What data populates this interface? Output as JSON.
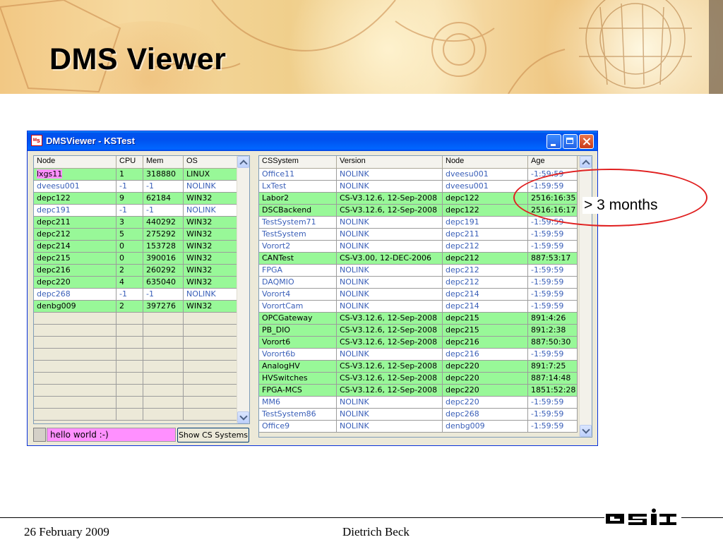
{
  "slide": {
    "title": "DMS Viewer",
    "footer_date": "26 February 2009",
    "footer_author": "Dietrich Beck",
    "logo_text": "GSI",
    "annotation": "> 3 months"
  },
  "window": {
    "title": "DMSViewer - KSTest",
    "icon": "app-icon"
  },
  "left_table": {
    "headers": [
      "Node",
      "CPU",
      "Mem",
      "OS"
    ],
    "rows": [
      {
        "node": "lxgs11",
        "cpu": "1",
        "mem": "318880",
        "os": "LINUX",
        "status": "ok",
        "highlight": true
      },
      {
        "node": "dveesu001",
        "cpu": "-1",
        "mem": "-1",
        "os": "NOLINK",
        "status": "nolink"
      },
      {
        "node": "depc122",
        "cpu": "9",
        "mem": "62184",
        "os": "WIN32",
        "status": "ok"
      },
      {
        "node": "depc191",
        "cpu": "-1",
        "mem": "-1",
        "os": "NOLINK",
        "status": "nolink"
      },
      {
        "node": "depc211",
        "cpu": "3",
        "mem": "440292",
        "os": "WIN32",
        "status": "ok"
      },
      {
        "node": "depc212",
        "cpu": "5",
        "mem": "275292",
        "os": "WIN32",
        "status": "ok"
      },
      {
        "node": "depc214",
        "cpu": "0",
        "mem": "153728",
        "os": "WIN32",
        "status": "ok"
      },
      {
        "node": "depc215",
        "cpu": "0",
        "mem": "390016",
        "os": "WIN32",
        "status": "ok"
      },
      {
        "node": "depc216",
        "cpu": "2",
        "mem": "260292",
        "os": "WIN32",
        "status": "ok"
      },
      {
        "node": "depc220",
        "cpu": "4",
        "mem": "635040",
        "os": "WIN32",
        "status": "ok"
      },
      {
        "node": "depc268",
        "cpu": "-1",
        "mem": "-1",
        "os": "NOLINK",
        "status": "nolink"
      },
      {
        "node": "denbg009",
        "cpu": "2",
        "mem": "397276",
        "os": "WIN32",
        "status": "ok"
      }
    ]
  },
  "right_table": {
    "headers": [
      "CSSystem",
      "Version",
      "Node",
      "Age"
    ],
    "rows": [
      {
        "cs": "Office11",
        "version": "NOLINK",
        "node": "dveesu001",
        "age": "-1:59:59",
        "status": "nolink"
      },
      {
        "cs": "LxTest",
        "version": "NOLINK",
        "node": "dveesu001",
        "age": "-1:59:59",
        "status": "nolink"
      },
      {
        "cs": "Labor2",
        "version": "CS-V3.12.6, 12-Sep-2008",
        "node": "depc122",
        "age": "2516:16:35",
        "status": "ok"
      },
      {
        "cs": "DSCBackend",
        "version": "CS-V3.12.6, 12-Sep-2008",
        "node": "depc122",
        "age": "2516:16:17",
        "status": "ok"
      },
      {
        "cs": "TestSystem71",
        "version": "NOLINK",
        "node": "depc191",
        "age": "-1:59:59",
        "status": "nolink"
      },
      {
        "cs": "TestSystem",
        "version": "NOLINK",
        "node": "depc211",
        "age": "-1:59:59",
        "status": "nolink"
      },
      {
        "cs": "Vorort2",
        "version": "NOLINK",
        "node": "depc212",
        "age": "-1:59:59",
        "status": "nolink"
      },
      {
        "cs": "CANTest",
        "version": "CS-V3.00, 12-DEC-2006",
        "node": "depc212",
        "age": "887:53:17",
        "status": "ok"
      },
      {
        "cs": "FPGA",
        "version": "NOLINK",
        "node": "depc212",
        "age": "-1:59:59",
        "status": "nolink"
      },
      {
        "cs": "DAQMIO",
        "version": "NOLINK",
        "node": "depc212",
        "age": "-1:59:59",
        "status": "nolink"
      },
      {
        "cs": "Vorort4",
        "version": "NOLINK",
        "node": "depc214",
        "age": "-1:59:59",
        "status": "nolink"
      },
      {
        "cs": "VorortCam",
        "version": "NOLINK",
        "node": "depc214",
        "age": "-1:59:59",
        "status": "nolink"
      },
      {
        "cs": "OPCGateway",
        "version": "CS-V3.12.6, 12-Sep-2008",
        "node": "depc215",
        "age": "891:4:26",
        "status": "ok"
      },
      {
        "cs": "PB_DIO",
        "version": "CS-V3.12.6, 12-Sep-2008",
        "node": "depc215",
        "age": "891:2:38",
        "status": "ok"
      },
      {
        "cs": "Vorort6",
        "version": "CS-V3.12.6, 12-Sep-2008",
        "node": "depc216",
        "age": "887:50:30",
        "status": "ok"
      },
      {
        "cs": "Vorort6b",
        "version": "NOLINK",
        "node": "depc216",
        "age": "-1:59:59",
        "status": "nolink"
      },
      {
        "cs": "AnalogHV",
        "version": "CS-V3.12.6, 12-Sep-2008",
        "node": "depc220",
        "age": "891:7:25",
        "status": "ok"
      },
      {
        "cs": "HVSwitches",
        "version": "CS-V3.12.6, 12-Sep-2008",
        "node": "depc220",
        "age": "887:14:48",
        "status": "ok"
      },
      {
        "cs": "FPGA-MCS",
        "version": "CS-V3.12.6, 12-Sep-2008",
        "node": "depc220",
        "age": "1851:52:28",
        "status": "ok"
      },
      {
        "cs": "MM6",
        "version": "NOLINK",
        "node": "depc220",
        "age": "-1:59:59",
        "status": "nolink"
      },
      {
        "cs": "TestSystem86",
        "version": "NOLINK",
        "node": "depc268",
        "age": "-1:59:59",
        "status": "nolink"
      },
      {
        "cs": "Office9",
        "version": "NOLINK",
        "node": "denbg009",
        "age": "-1:59:59",
        "status": "nolink"
      }
    ]
  },
  "status_bar": {
    "message": "hello world :-)",
    "show_cs_button": "Show CS Systems"
  },
  "colors": {
    "ok_row": "#98f898",
    "nolink_text": "#3a5fb8",
    "highlight": "#ff90ff",
    "annotation": "#e02020"
  }
}
